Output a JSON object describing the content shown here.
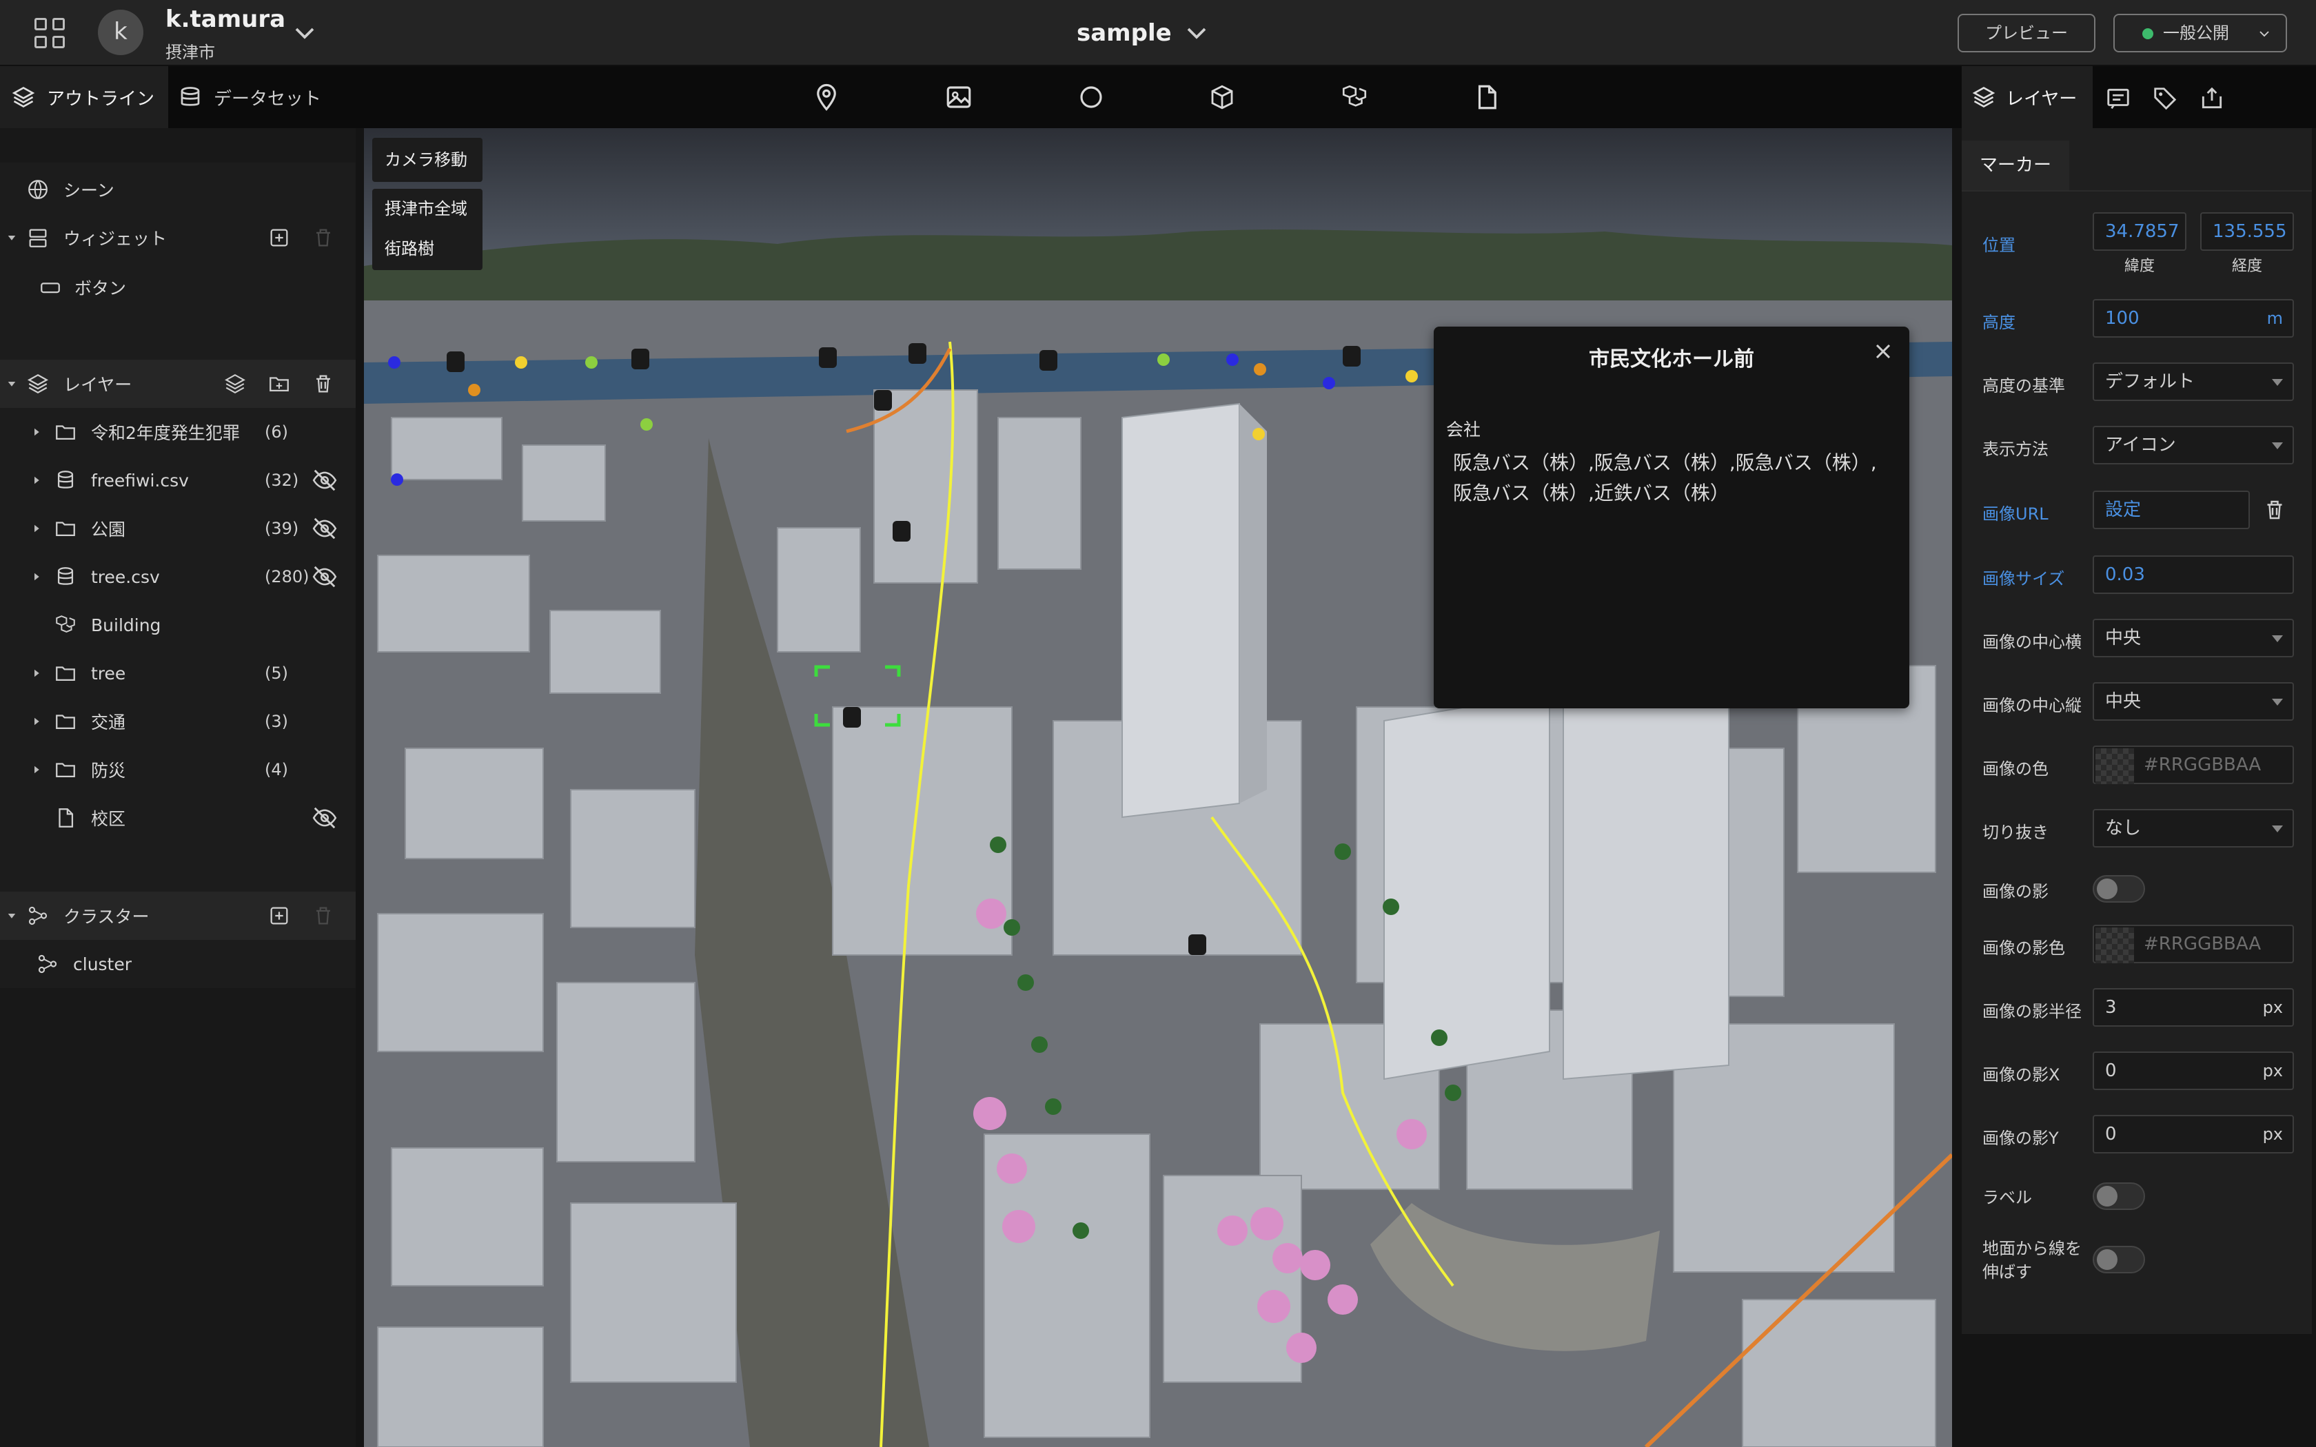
{
  "header": {
    "user_initial": "k",
    "user_name": "k.tamura",
    "org_name": "摂津市",
    "project_title": "sample",
    "preview_label": "プレビュー",
    "publish_label": "一般公開"
  },
  "left_tabs": {
    "outline": "アウトライン",
    "dataset": "データセット"
  },
  "right_tabs": {
    "layer": "レイヤー"
  },
  "sidebar": {
    "scene": "シーン",
    "widgets_header": "ウィジェット",
    "widget_button": "ボタン",
    "layers_header": "レイヤー",
    "layers": [
      {
        "name": "令和2年度発生犯罪",
        "count": "(6)"
      },
      {
        "name": "freefiwi.csv",
        "count": "(32)"
      },
      {
        "name": "公園",
        "count": "(39)"
      },
      {
        "name": "tree.csv",
        "count": "(280)"
      },
      {
        "name": "Building",
        "count": ""
      },
      {
        "name": "tree",
        "count": "(5)"
      },
      {
        "name": "交通",
        "count": "(3)"
      },
      {
        "name": "防災",
        "count": "(4)"
      },
      {
        "name": "校区",
        "count": ""
      }
    ],
    "cluster_header": "クラスター",
    "cluster_item": "cluster"
  },
  "viewport": {
    "story_button": "カメラ移動",
    "story_items": [
      "摂津市全域",
      "街路樹"
    ]
  },
  "infobox": {
    "title": "市民文化ホール前",
    "field_key": "会社",
    "field_value": "阪急バス（株）,阪急バス（株）,阪急バス（株）,阪急バス（株）,近鉄バス（株）"
  },
  "inspector": {
    "tab": "マーカー",
    "position_label": "位置",
    "latitude": "34.7857",
    "longitude": "135.555",
    "latitude_caption": "緯度",
    "longitude_caption": "経度",
    "height_label": "高度",
    "height_value": "100",
    "height_unit": "m",
    "height_ref_label": "高度の基準",
    "height_ref_value": "デフォルト",
    "display_label": "表示方法",
    "display_value": "アイコン",
    "image_url_label": "画像URL",
    "image_url_value": "設定",
    "image_size_label": "画像サイズ",
    "image_size_value": "0.03",
    "center_x_label": "画像の中心横",
    "center_x_value": "中央",
    "center_y_label": "画像の中心縦",
    "center_y_value": "中央",
    "image_color_label": "画像の色",
    "image_color_placeholder": "#RRGGBBAA",
    "crop_label": "切り抜き",
    "crop_value": "なし",
    "shadow_label": "画像の影",
    "shadow_color_label": "画像の影色",
    "shadow_color_placeholder": "#RRGGBBAA",
    "shadow_radius_label": "画像の影半径",
    "shadow_radius_value": "3",
    "shadow_x_label": "画像の影X",
    "shadow_x_value": "0",
    "shadow_y_label": "画像の影Y",
    "shadow_y_value": "0",
    "px_unit": "px",
    "label_label": "ラベル",
    "extrude_label_1": "地面から線を",
    "extrude_label_2": "伸ばす"
  },
  "colors": {
    "accent_blue": "#4a90e2",
    "publish_dot": "#3dbb6c",
    "selection_green": "#3ddc3d"
  }
}
